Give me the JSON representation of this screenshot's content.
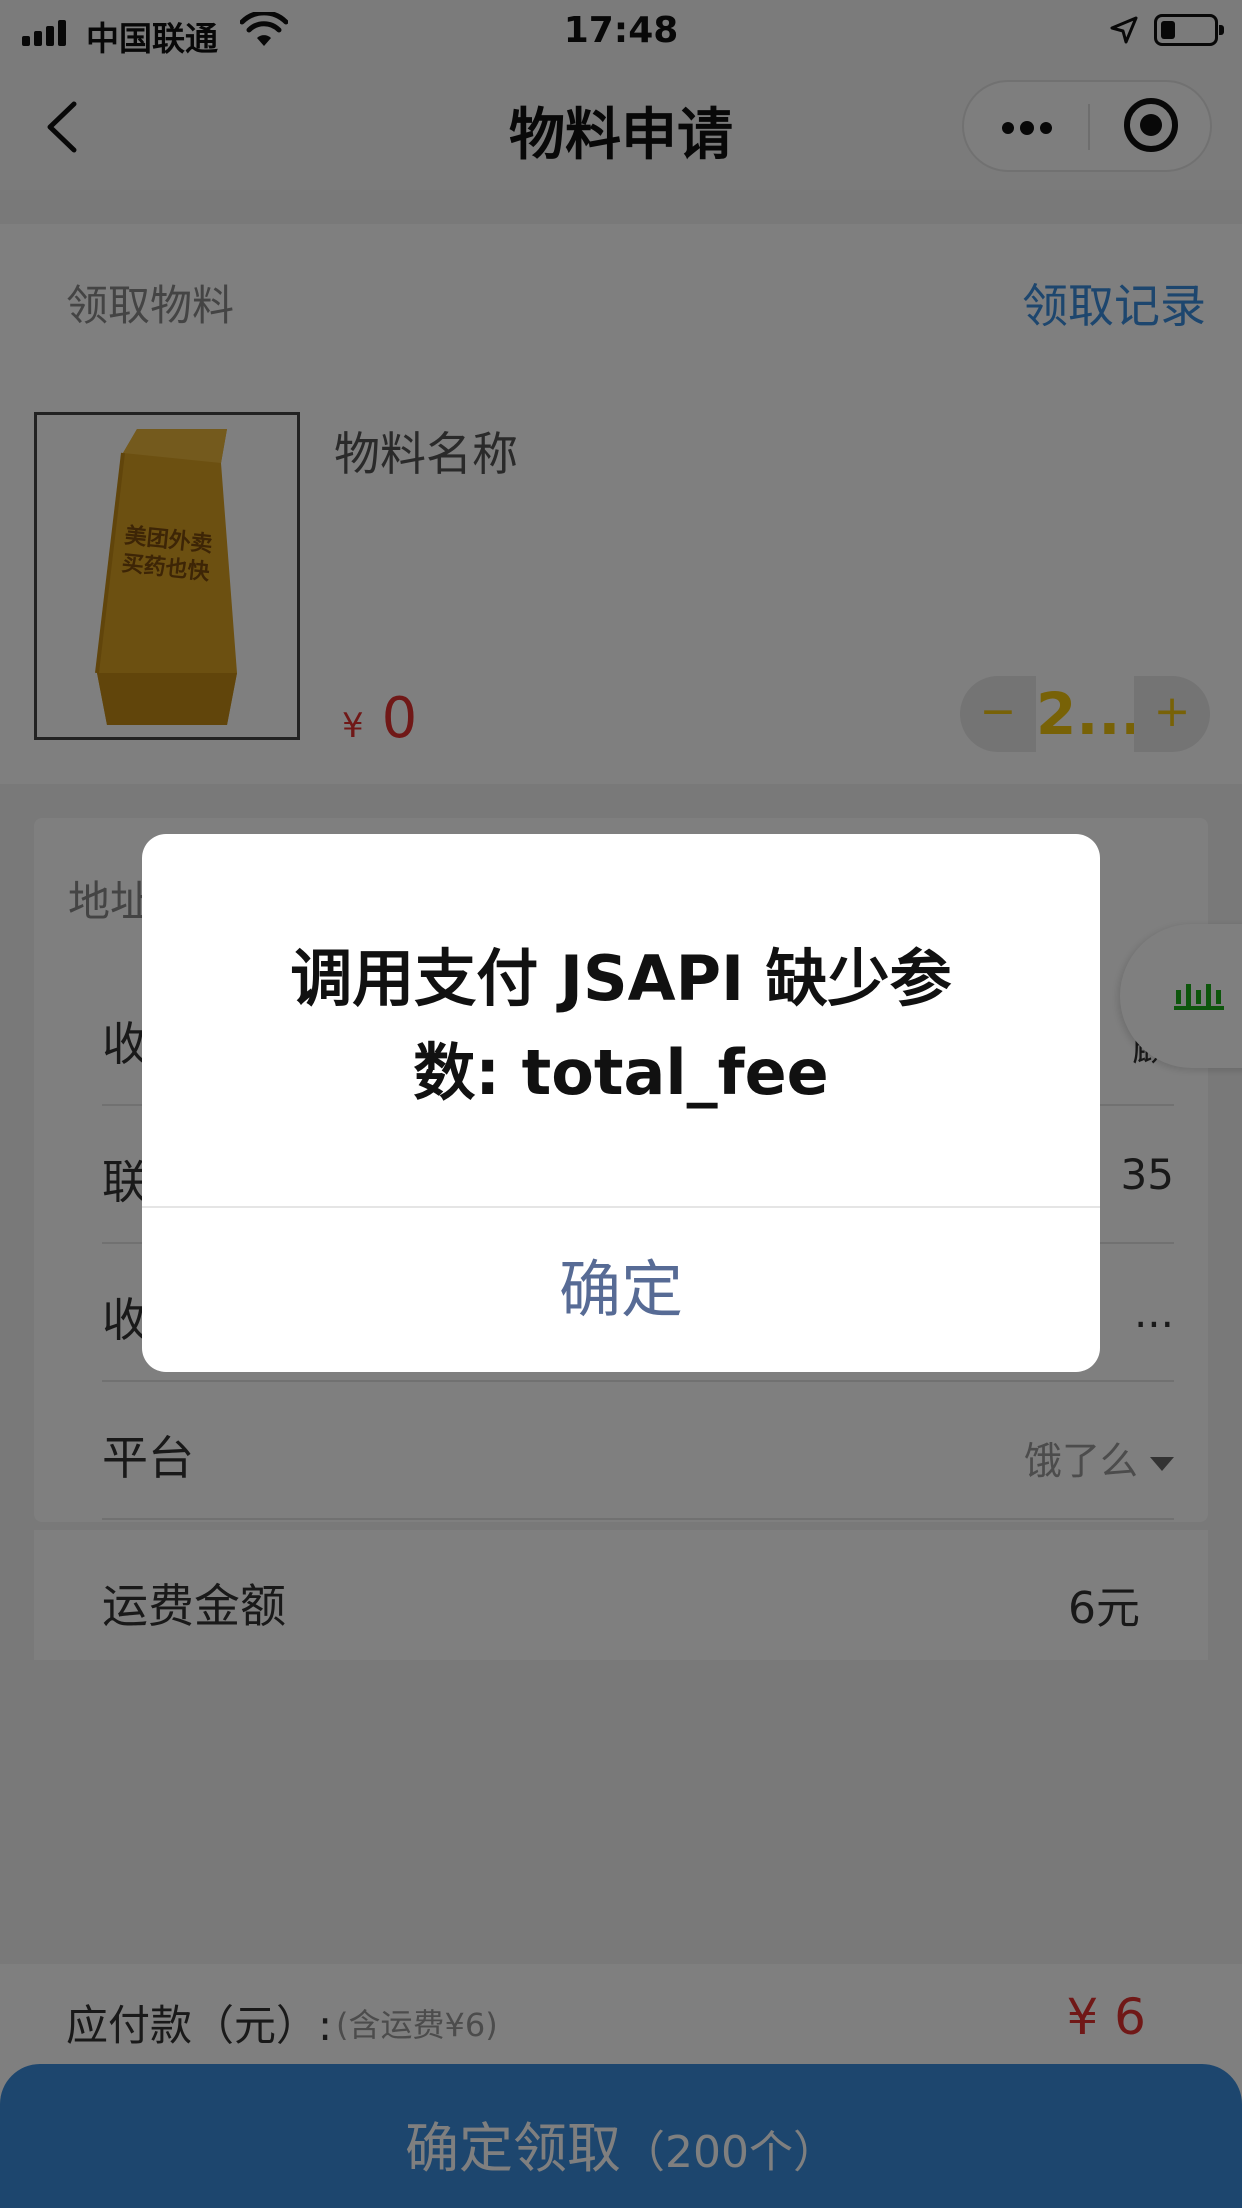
{
  "status_bar": {
    "carrier": "中国联通",
    "time": "17:48"
  },
  "nav": {
    "title": "物料申请"
  },
  "material": {
    "section_title": "领取物料",
    "record_link": "领取记录",
    "name": "物料名称",
    "image_text": "美团外卖\n买药也快",
    "currency": "¥",
    "price": "0",
    "quantity": "2...",
    "minus": "−",
    "plus": "+"
  },
  "address": {
    "title": "地址",
    "rows": [
      {
        "label": "收",
        "value": "麟"
      },
      {
        "label": "联",
        "value": "35"
      },
      {
        "label": "收",
        "value": "..."
      },
      {
        "label": "平台",
        "value": "饿了么"
      }
    ]
  },
  "freight": {
    "label": "运费金额",
    "value": "6元"
  },
  "footer": {
    "pay_label": "应付款（元）:",
    "pay_note": "(含运费¥6)",
    "pay_total": "¥ 6",
    "confirm_label": "确定领取",
    "confirm_count": "（200个）"
  },
  "dialog": {
    "message_line1": "调用支付 JSAPI 缺少参",
    "message_line2": "数: total_fee",
    "ok_label": "确定"
  },
  "colors": {
    "accent_blue": "#3a8ddc",
    "price_red": "#e0312e",
    "stepper_yellow": "#f1c40f",
    "dialog_button": "#576b95",
    "mini_program_green": "#1aad19"
  }
}
